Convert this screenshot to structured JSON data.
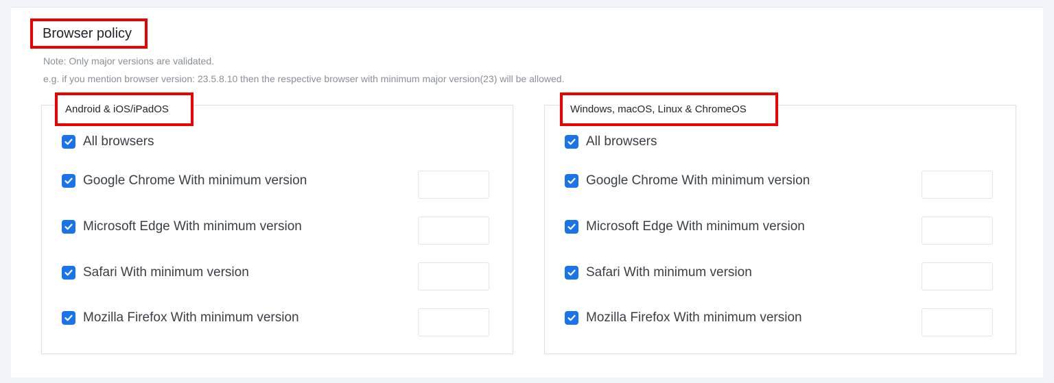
{
  "section": {
    "title": "Browser policy",
    "note_line1": "Note: Only major versions are validated.",
    "note_line2": "e.g. if you mention browser version: 23.5.8.10 then the respective browser with minimum major version(23) will be allowed."
  },
  "mobile": {
    "legend": "Android & iOS/iPadOS",
    "items": [
      {
        "label": "All browsers",
        "checked": true,
        "version": ""
      },
      {
        "label": "Google Chrome With minimum version",
        "checked": true,
        "version": ""
      },
      {
        "label": "Microsoft Edge With minimum version",
        "checked": true,
        "version": ""
      },
      {
        "label": "Safari With minimum version",
        "checked": true,
        "version": ""
      },
      {
        "label": "Mozilla Firefox With minimum version",
        "checked": true,
        "version": ""
      }
    ]
  },
  "desktop": {
    "legend": "Windows, macOS, Linux & ChromeOS",
    "items": [
      {
        "label": "All browsers",
        "checked": true,
        "version": ""
      },
      {
        "label": "Google Chrome With minimum version",
        "checked": true,
        "version": ""
      },
      {
        "label": "Microsoft Edge With minimum version",
        "checked": true,
        "version": ""
      },
      {
        "label": "Safari With minimum version",
        "checked": true,
        "version": ""
      },
      {
        "label": "Mozilla Firefox With minimum version",
        "checked": true,
        "version": ""
      }
    ]
  },
  "colors": {
    "checkbox": "#1a73e8",
    "highlight": "#ec0000"
  }
}
